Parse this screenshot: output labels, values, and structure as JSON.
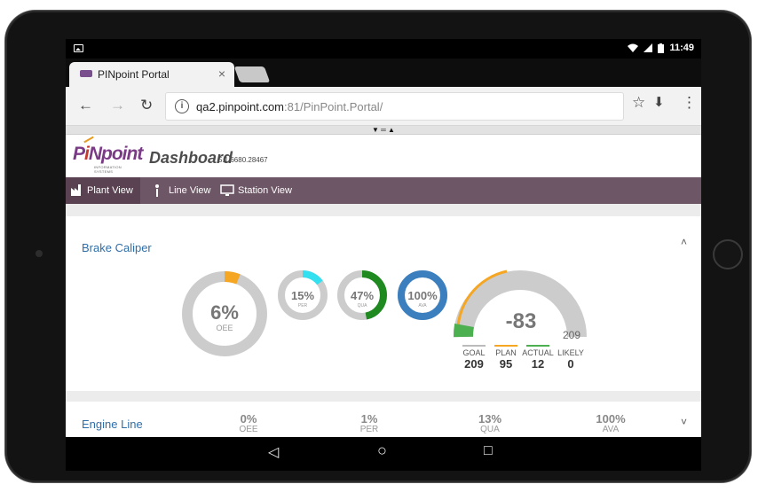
{
  "status": {
    "time": "11:49"
  },
  "browser": {
    "tab_title": "PINpoint Portal",
    "tab_close": "×",
    "url_host": "qa2.pinpoint.com",
    "url_rest": ":81/PinPoint.Portal/"
  },
  "splitter": "▼ ═ ▲",
  "app": {
    "logo_pi": "P",
    "logo_i": "i",
    "logo_n": "N",
    "logo_rest": "point",
    "logo_sub": "INFORMATION SYSTEMS",
    "title": "Dashboard",
    "version": "5.1.6680.28467"
  },
  "menu": {
    "plant_view": "Plant View",
    "line_view": "Line View",
    "station_view": "Station View"
  },
  "panels": {
    "brake": {
      "title": "Brake Caliper",
      "oee": {
        "value": "6%",
        "label": "OEE",
        "fraction": 0.06,
        "color": "#f5a623"
      },
      "per": {
        "value": "15%",
        "label": "PER",
        "fraction": 0.15,
        "color": "#33e0f0"
      },
      "qua": {
        "value": "47%",
        "label": "QUA",
        "fraction": 0.47,
        "color": "#1f8a1f"
      },
      "ava": {
        "value": "100%",
        "label": "AVA",
        "fraction": 1.0,
        "color": "#3b7fbf"
      },
      "gauge": {
        "value": "-83",
        "max": "209"
      },
      "goal": {
        "label": "GOAL",
        "value": "209",
        "color": "#bbbbbb"
      },
      "plan": {
        "label": "PLAN",
        "value": "95",
        "color": "#f5a623"
      },
      "actual": {
        "label": "ACTUAL",
        "value": "12",
        "color": "#4caf50"
      },
      "likely": {
        "label": "LIKELY",
        "value": "0",
        "color": "#ffffff"
      }
    },
    "engine": {
      "title": "Engine Line",
      "oee": {
        "value": "0%",
        "label": "OEE"
      },
      "per": {
        "value": "1%",
        "label": "PER"
      },
      "qua": {
        "value": "13%",
        "label": "QUA"
      },
      "ava": {
        "value": "100%",
        "label": "AVA"
      }
    }
  },
  "icons": {
    "back": "←",
    "forward": "→",
    "reload": "↻",
    "star": "☆",
    "download": "⬇",
    "kebab": "⋮",
    "collapse": "˄",
    "expand": "˅",
    "nav_back": "◁",
    "nav_home": "○",
    "nav_recent": "□"
  }
}
